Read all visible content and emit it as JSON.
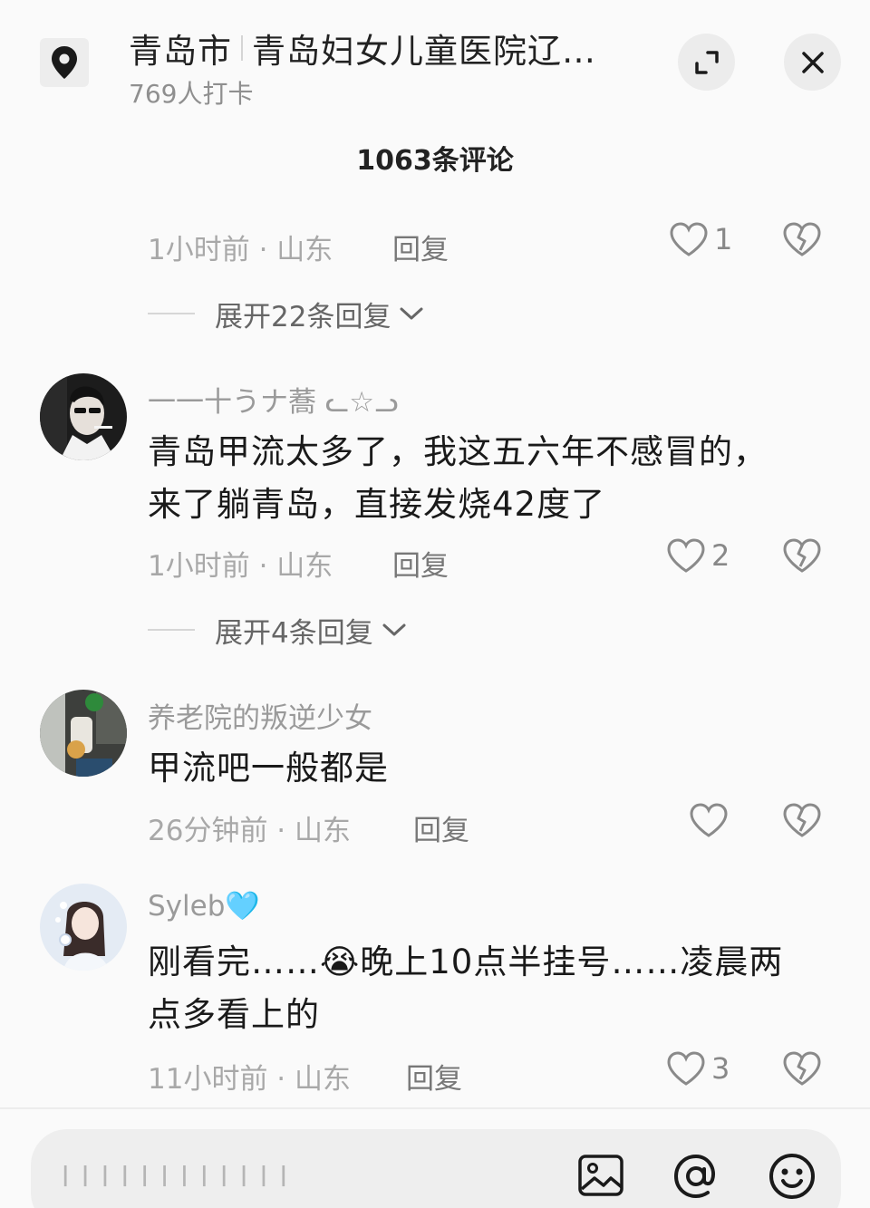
{
  "header": {
    "city": "青岛市",
    "place": "青岛妇女儿童医院辽…",
    "checkins": "769人打卡",
    "icons": {
      "location": "location-pin-icon",
      "expand": "expand-icon",
      "close": "close-icon"
    }
  },
  "comment_count": "1063条评论",
  "comments": [
    {
      "time_location": "1小时前 · 山东",
      "reply": "回复",
      "likes": "1",
      "expand": "展开22条回复"
    },
    {
      "username": "一一十うナ蕎 ᓚ☆ᓗ",
      "text_line1": "青岛甲流太多了，我这五六年不感冒的，",
      "text_line2": "来了躺青岛，直接发烧42度了",
      "time_location": "1小时前 · 山东",
      "reply": "回复",
      "likes": "2",
      "expand": "展开4条回复"
    },
    {
      "username": "养老院的叛逆少女",
      "text_line1": "甲流吧一般都是",
      "time_location": "26分钟前 · 山东",
      "reply": "回复",
      "likes": ""
    },
    {
      "username": "Syleb🩵",
      "text_line1": "刚看完……😭晚上10点半挂号……凌晨两",
      "text_line2": "点多看上的",
      "time_location": "11小时前 · 山东",
      "reply": "回复",
      "likes": "3"
    }
  ],
  "input": {
    "placeholder": "l l l l l l l l l l l l"
  },
  "colors": {
    "background": "#fafafa",
    "muted": "#a8a8a8",
    "text": "#1a1a1a"
  }
}
